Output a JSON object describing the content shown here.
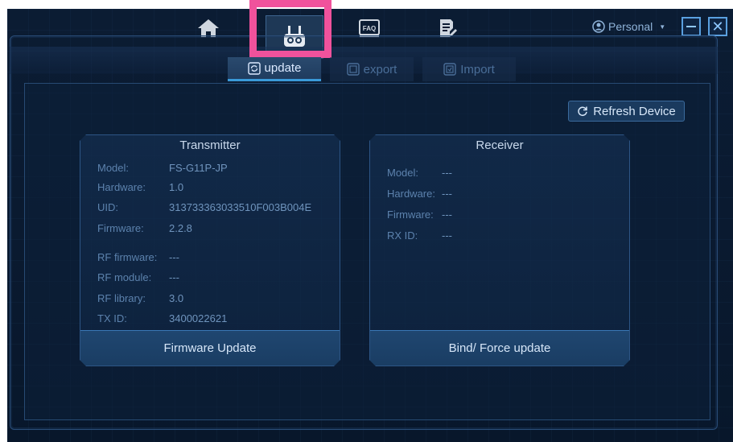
{
  "nav": {
    "home_icon": "home-icon",
    "device_icon": "transmitter-icon",
    "faq_label": "FAQ",
    "doc_icon": "document-icon",
    "user_label": "Personal"
  },
  "tabs": [
    {
      "label": "update",
      "icon": "update-icon",
      "active": true
    },
    {
      "label": "export",
      "icon": "export-icon",
      "active": false
    },
    {
      "label": "Import",
      "icon": "import-icon",
      "active": false
    }
  ],
  "refresh_label": "Refresh Device",
  "transmitter": {
    "title": "Transmitter",
    "fields": [
      {
        "label": "Model:",
        "value": "FS-G11P-JP"
      },
      {
        "label": "Hardware:",
        "value": "1.0"
      },
      {
        "label": "UID:",
        "value": "313733363033510F003B004E"
      },
      {
        "label": "Firmware:",
        "value": "2.2.8"
      },
      {
        "label": "RF firmware:",
        "value": "---"
      },
      {
        "label": "RF module:",
        "value": "---"
      },
      {
        "label": "RF library:",
        "value": "3.0"
      },
      {
        "label": "TX ID:",
        "value": "3400022621"
      }
    ],
    "button_label": "Firmware Update"
  },
  "receiver": {
    "title": "Receiver",
    "fields": [
      {
        "label": "Model:",
        "value": "---"
      },
      {
        "label": "Hardware:",
        "value": "---"
      },
      {
        "label": "Firmware:",
        "value": "---"
      },
      {
        "label": "RX ID:",
        "value": "---"
      }
    ],
    "button_label": "Bind/ Force update"
  },
  "colors": {
    "accent": "#3a9ad8",
    "highlight": "#f0529c",
    "background": "#0b1c33"
  }
}
